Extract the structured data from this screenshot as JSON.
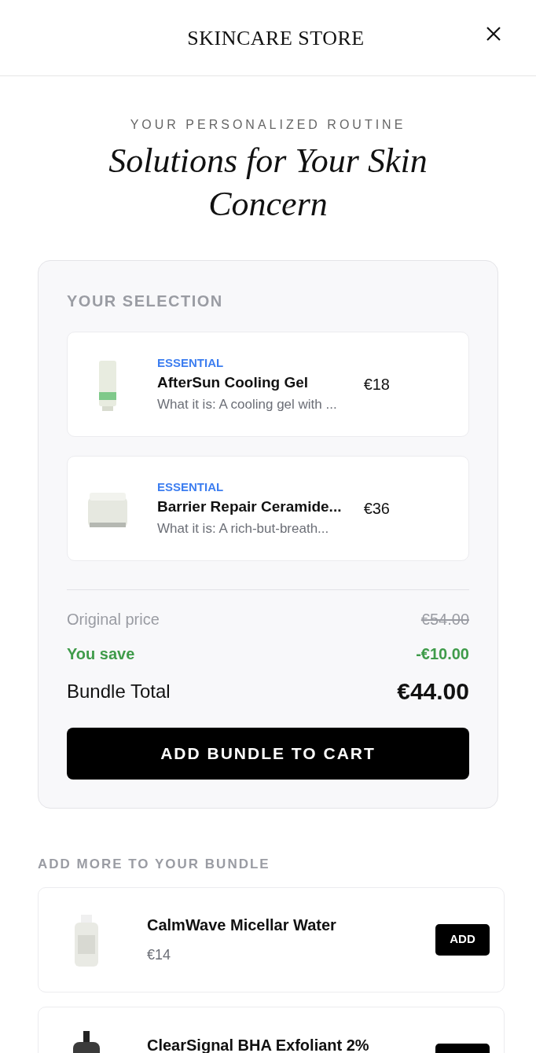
{
  "header": {
    "title": "SKINCARE STORE"
  },
  "eyebrow": "YOUR PERSONALIZED ROUTINE",
  "heading": "Solutions for Your Skin Concern",
  "selection": {
    "title": "YOUR SELECTION",
    "items": [
      {
        "tag": "ESSENTIAL",
        "name": "AfterSun Cooling Gel",
        "description": "What it is: A cooling gel with ...",
        "price": "€18"
      },
      {
        "tag": "ESSENTIAL",
        "name": "Barrier Repair Ceramide...",
        "description": "What it is: A rich-but-breath...",
        "price": "€36"
      }
    ],
    "original_label": "Original price",
    "original_value": "€54.00",
    "save_label": "You save",
    "save_value": "-€10.00",
    "total_label": "Bundle Total",
    "total_value": "€44.00",
    "button": "ADD BUNDLE TO CART"
  },
  "more": {
    "title": "ADD MORE TO YOUR BUNDLE",
    "items": [
      {
        "name": "CalmWave Micellar Water",
        "price": "€14",
        "button": "ADD"
      },
      {
        "name": "ClearSignal BHA Exfoliant 2%"
      }
    ]
  }
}
